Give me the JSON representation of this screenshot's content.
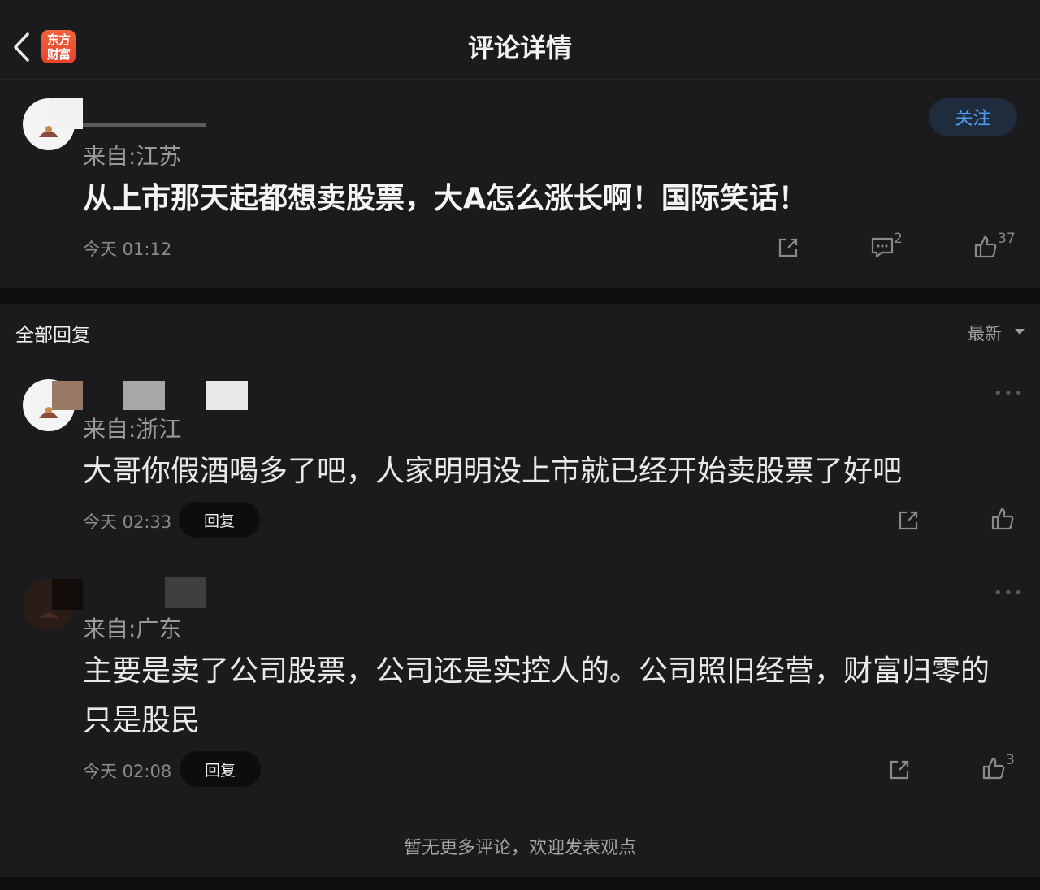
{
  "header": {
    "title": "评论详情",
    "logo_line1": "东方",
    "logo_line2": "财富"
  },
  "main_comment": {
    "from": "来自:江苏",
    "text": "从上市那天起都想卖股票，大A怎么涨长啊！国际笑话！",
    "time": "今天 01:12",
    "follow_label": "关注",
    "reply_count": "2",
    "like_count": "37"
  },
  "replies_section": {
    "title": "全部回复",
    "sort_label": "最新"
  },
  "replies": [
    {
      "from": "来自:浙江",
      "text": "大哥你假酒喝多了吧，人家明明没上市就已经开始卖股票了好吧",
      "time": "今天 02:33",
      "reply_label": "回复",
      "like_count": ""
    },
    {
      "from": "来自:广东",
      "text": "主要是卖了公司股票，公司还是实控人的。公司照旧经营，财富归零的只是股民",
      "time": "今天 02:08",
      "reply_label": "回复",
      "like_count": "3"
    }
  ],
  "footer": {
    "note": "暂无更多评论，欢迎发表观点"
  },
  "icons": {
    "back": "chevron-left-icon",
    "share": "share-icon",
    "comment": "comment-icon",
    "like": "thumbs-up-icon",
    "more": "more-dots-icon"
  },
  "colors": {
    "background": "#1b1b1d",
    "accent": "#4e9bf0",
    "logo": "#e9432a"
  }
}
